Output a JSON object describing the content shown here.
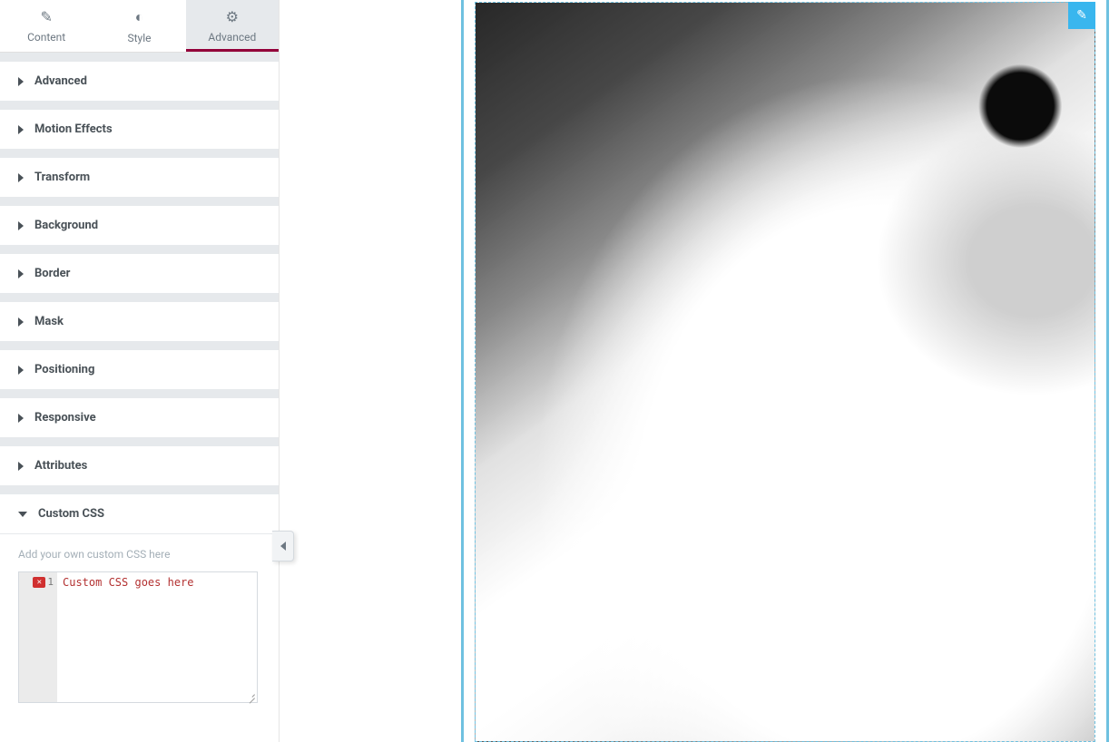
{
  "tabs": {
    "content": "Content",
    "style": "Style",
    "advanced": "Advanced"
  },
  "sections": {
    "advanced": "Advanced",
    "motion_effects": "Motion Effects",
    "transform": "Transform",
    "background": "Background",
    "border": "Border",
    "mask": "Mask",
    "positioning": "Positioning",
    "responsive": "Responsive",
    "attributes": "Attributes",
    "custom_css": "Custom CSS"
  },
  "custom_css": {
    "help": "Add your own custom CSS here",
    "placeholder": "Custom CSS goes here",
    "line_number": "1",
    "error_marker": "✕"
  },
  "preview": {
    "element_type": "image"
  }
}
